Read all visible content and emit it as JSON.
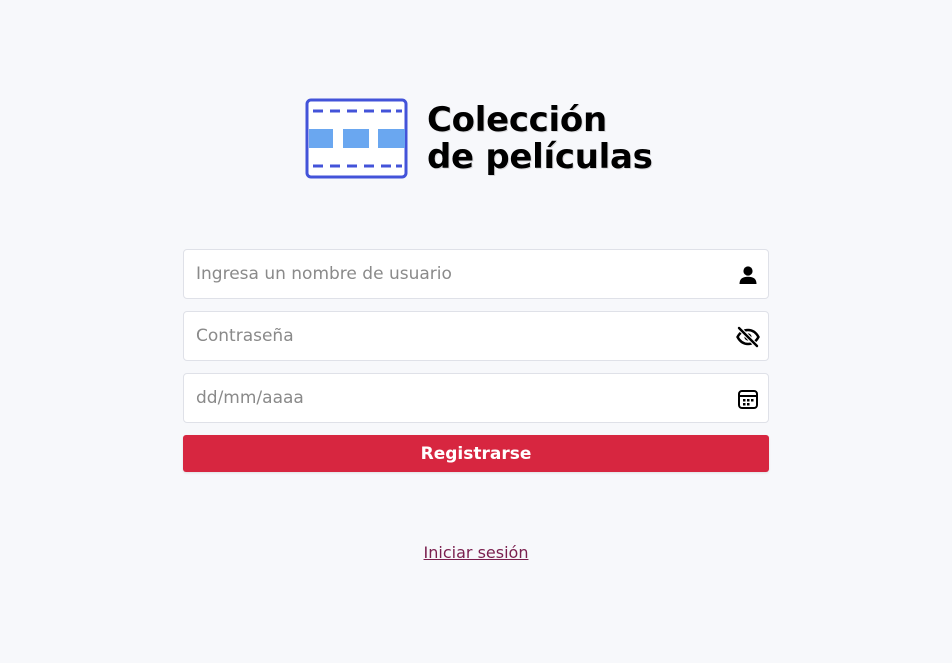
{
  "app": {
    "title_line1": "Colección",
    "title_line2": "de películas",
    "logo_icon": "film-strip-icon",
    "brand_color": "#4353d9",
    "accent_color": "#6aa7f0"
  },
  "form": {
    "username": {
      "placeholder": "Ingresa un nombre de usuario",
      "value": "",
      "icon": "user-icon"
    },
    "password": {
      "placeholder": "Contraseña",
      "value": "",
      "icon": "eye-off-icon"
    },
    "birthdate": {
      "placeholder": "dd/mm/aaaa",
      "value": "",
      "icon": "calendar-icon"
    },
    "submit_label": "Registrarse",
    "submit_color": "#d72640"
  },
  "footer": {
    "login_link": "Iniciar sesión"
  }
}
